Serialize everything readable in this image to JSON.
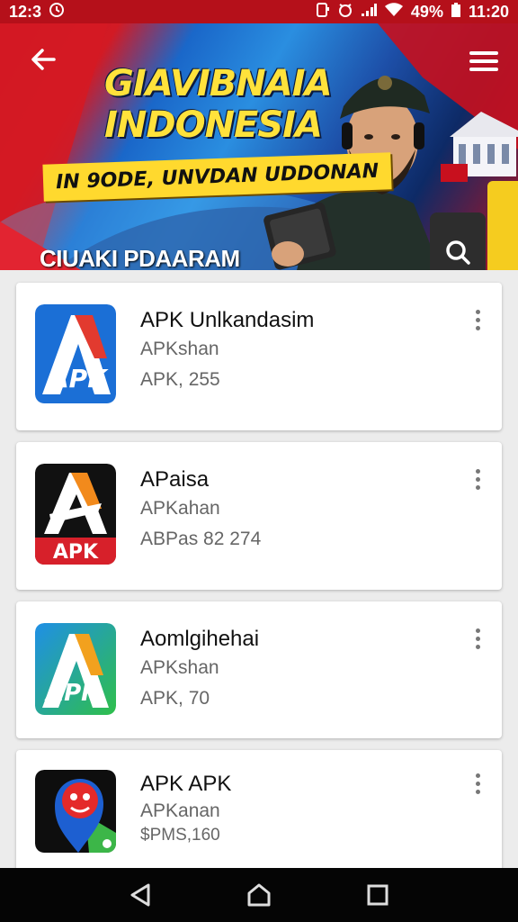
{
  "status_bar": {
    "left_time": "12:3",
    "left_icon": "clock-circle-icon",
    "battery": "49%",
    "time": "11:20",
    "icons": [
      "sim-icon",
      "alarm-icon",
      "signal-icon",
      "wifi-icon",
      "battery-icon"
    ]
  },
  "banner": {
    "title_line1": "GIAVIBNAIA",
    "title_line2": "INDONESIA",
    "subtitle": "IN 9ODE, UNVDAN UDDONAN",
    "label": "CIUAKI PDAARAM",
    "colors": {
      "red": "#c8101e",
      "blue": "#2a8ee0",
      "yellow": "#ffe23b"
    }
  },
  "apps": [
    {
      "name": "APK Unlkandasim",
      "developer": "APKshan",
      "meta": "APK, 255",
      "icon": "apk-logo-blue-icon"
    },
    {
      "name": "APaisa",
      "developer": "APKahan",
      "meta": "ABPas 82 274",
      "icon": "apk-logo-black-red-icon",
      "badge": "APK"
    },
    {
      "name": "Aomlgihehai",
      "developer": "APKshan",
      "meta": "APK, 70",
      "icon": "apk-logo-green-icon"
    },
    {
      "name": "APK APK",
      "developer": "APKanan",
      "meta": "$PMS,160",
      "icon": "apk-map-pin-icon"
    }
  ],
  "nav": {
    "back": "back-triangle-icon",
    "home": "home-icon",
    "recents": "recents-square-icon"
  }
}
